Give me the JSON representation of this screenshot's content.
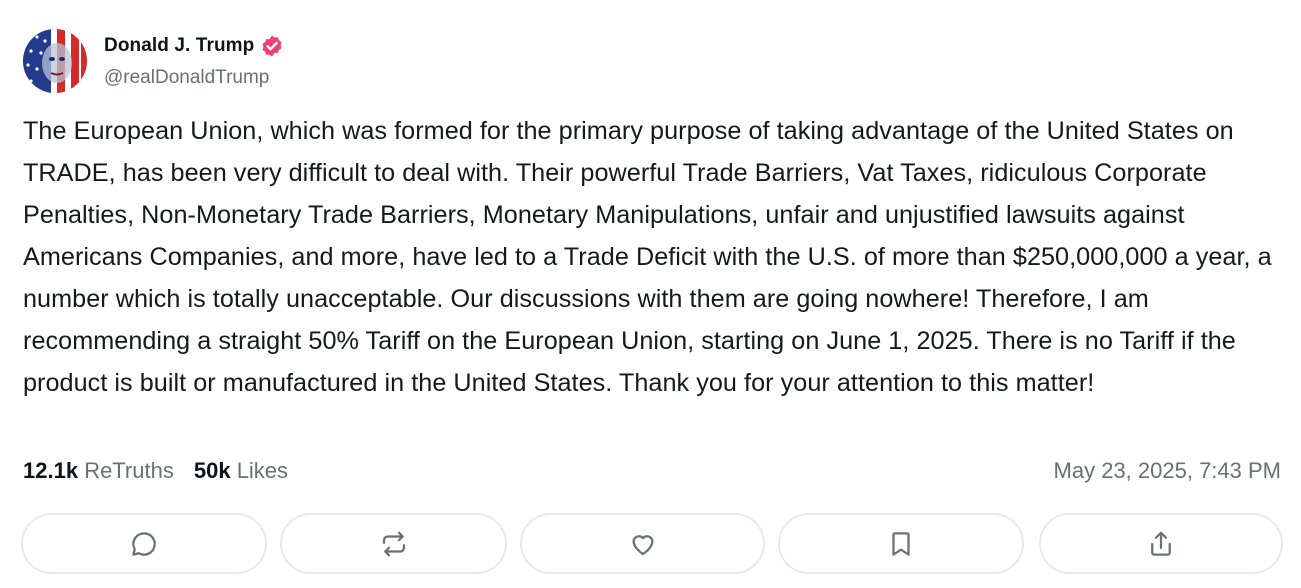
{
  "author": {
    "name": "Donald J. Trump",
    "handle": "@realDonaldTrump",
    "verified": true,
    "verified_color": "#f0426f"
  },
  "post": {
    "text": "The European Union, which was formed for the primary purpose of taking advantage of the United States on TRADE, has been very difficult to deal with. Their powerful Trade Barriers, Vat Taxes, ridiculous Corporate Penalties, Non-Monetary Trade Barriers, Monetary Manipulations, unfair and unjustified lawsuits against Americans Companies, and more, have led to a Trade Deficit with the U.S. of more than $250,000,000 a year, a number which is totally unacceptable. Our discussions with them are going nowhere! Therefore, I am recommending a straight 50% Tariff on the European Union, starting on June 1, 2025. There is no Tariff if the product is built or manufactured in the United States. Thank you for your attention to this matter!"
  },
  "stats": {
    "retruths_count": "12.1k",
    "retruths_label": "ReTruths",
    "likes_count": "50k",
    "likes_label": "Likes"
  },
  "timestamp": "May 23, 2025, 7:43 PM",
  "actions": [
    {
      "icon": "reply-icon"
    },
    {
      "icon": "retruth-icon"
    },
    {
      "icon": "like-icon"
    },
    {
      "icon": "bookmark-icon"
    },
    {
      "icon": "share-icon"
    }
  ]
}
